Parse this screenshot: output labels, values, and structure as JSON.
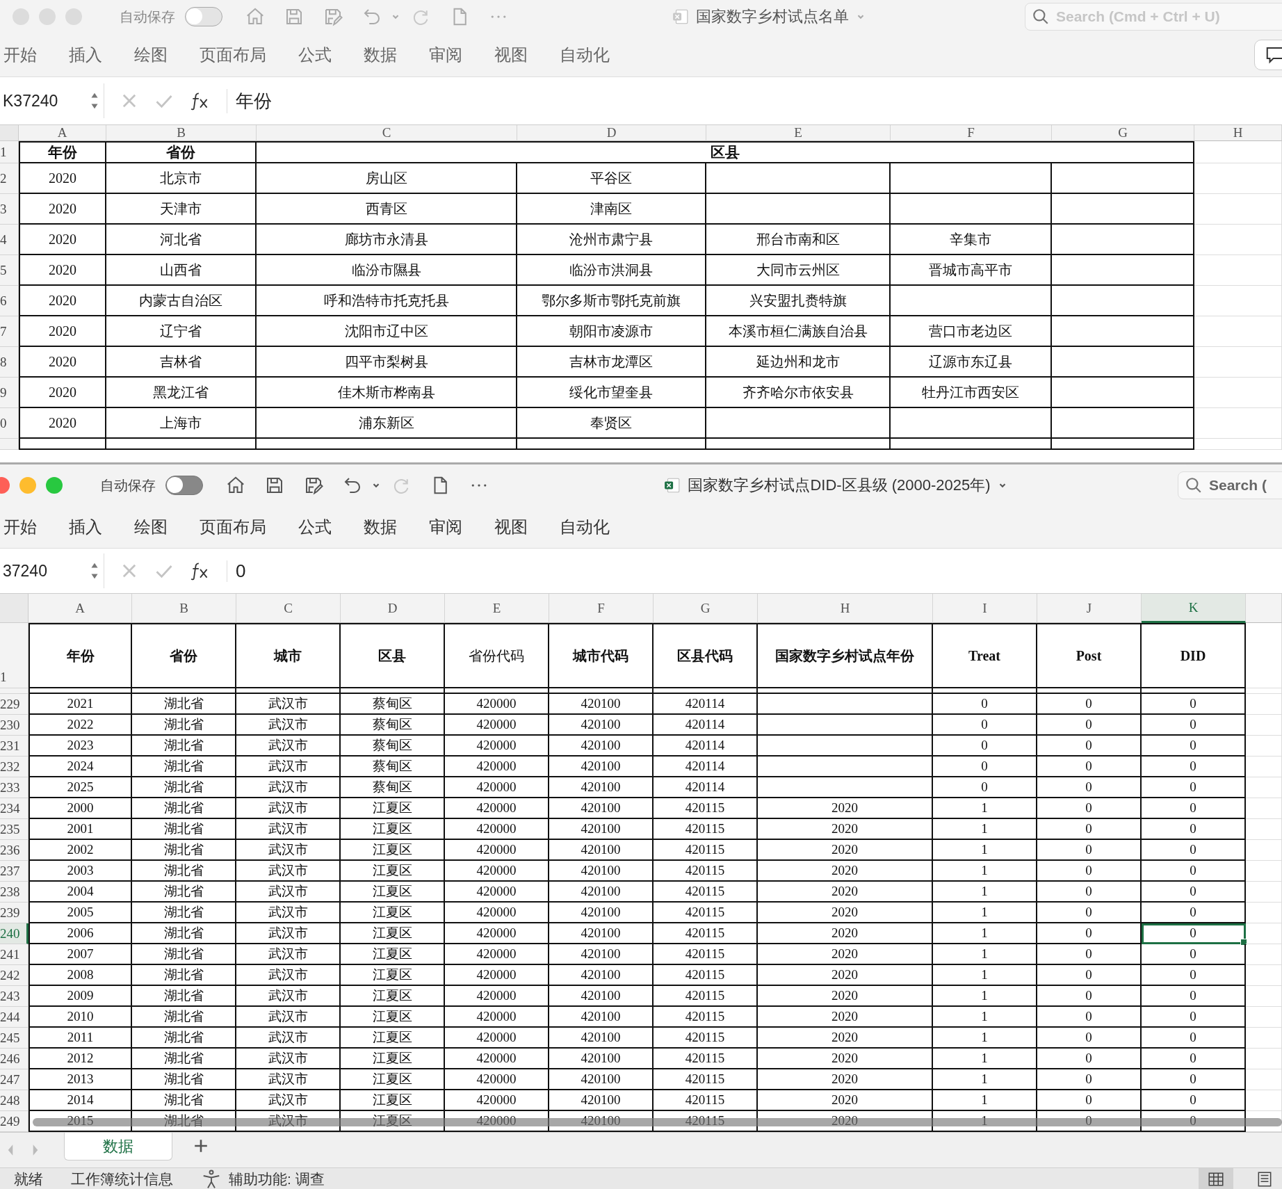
{
  "back_window": {
    "active": false,
    "autosave_label": "自动保存",
    "autosave_on": false,
    "title": "国家数字乡村试点名单",
    "search_placeholder": "Search (Cmd + Ctrl + U)",
    "comment_button": true,
    "ribbon_tabs": [
      "开始",
      "插入",
      "绘图",
      "页面布局",
      "公式",
      "数据",
      "审阅",
      "视图",
      "自动化"
    ],
    "name_box": "K37240",
    "formula": "年份",
    "columns": [
      "A",
      "B",
      "C",
      "D",
      "E",
      "F",
      "G",
      "H"
    ],
    "header_row": {
      "number": "1",
      "cells": [
        "年份",
        "省份",
        "区县"
      ]
    },
    "rows": [
      {
        "number": "2",
        "cells": [
          "2020",
          "北京市",
          "房山区",
          "平谷区",
          null,
          null,
          null
        ]
      },
      {
        "number": "3",
        "cells": [
          "2020",
          "天津市",
          "西青区",
          "津南区",
          null,
          null,
          null
        ]
      },
      {
        "number": "4",
        "cells": [
          "2020",
          "河北省",
          "廊坊市永清县",
          "沧州市肃宁县",
          "邢台市南和区",
          "辛集市",
          null
        ]
      },
      {
        "number": "5",
        "cells": [
          "2020",
          "山西省",
          "临汾市隰县",
          "临汾市洪洞县",
          "大同市云州区",
          "晋城市高平市",
          null
        ]
      },
      {
        "number": "6",
        "cells": [
          "2020",
          "内蒙古自治区",
          "呼和浩特市托克托县",
          "鄂尔多斯市鄂托克前旗",
          "兴安盟扎赉特旗",
          null,
          null
        ]
      },
      {
        "number": "7",
        "cells": [
          "2020",
          "辽宁省",
          "沈阳市辽中区",
          "朝阳市凌源市",
          "本溪市桓仁满族自治县",
          "营口市老边区",
          null
        ]
      },
      {
        "number": "8",
        "cells": [
          "2020",
          "吉林省",
          "四平市梨树县",
          "吉林市龙潭区",
          "延边州和龙市",
          "辽源市东辽县",
          null
        ]
      },
      {
        "number": "9",
        "cells": [
          "2020",
          "黑龙江省",
          "佳木斯市桦南县",
          "绥化市望奎县",
          "齐齐哈尔市依安县",
          "牡丹江市西安区",
          null
        ]
      },
      {
        "number": "0",
        "cells": [
          "2020",
          "上海市",
          "浦东新区",
          "奉贤区",
          null,
          null,
          null
        ]
      }
    ]
  },
  "front_window": {
    "active": true,
    "autosave_label": "自动保存",
    "autosave_on": false,
    "title": "国家数字乡村试点DID-区县级 (2000-2025年)",
    "search_placeholder": "Search (",
    "ribbon_tabs": [
      "开始",
      "插入",
      "绘图",
      "页面布局",
      "公式",
      "数据",
      "审阅",
      "视图",
      "自动化"
    ],
    "name_box": "37240",
    "formula": "0",
    "columns": [
      {
        "letter": "A",
        "selected": false
      },
      {
        "letter": "B",
        "selected": false
      },
      {
        "letter": "C",
        "selected": false
      },
      {
        "letter": "D",
        "selected": false
      },
      {
        "letter": "E",
        "selected": false
      },
      {
        "letter": "F",
        "selected": false
      },
      {
        "letter": "G",
        "selected": false
      },
      {
        "letter": "H",
        "selected": false
      },
      {
        "letter": "I",
        "selected": false
      },
      {
        "letter": "J",
        "selected": false
      },
      {
        "letter": "K",
        "selected": true
      }
    ],
    "header_row": {
      "number": "1",
      "cells": [
        {
          "text": "年份",
          "bold": true
        },
        {
          "text": "省份",
          "bold": true
        },
        {
          "text": "城市",
          "bold": true
        },
        {
          "text": "区县",
          "bold": true
        },
        {
          "text": "省份代码",
          "bold": false
        },
        {
          "text": "城市代码",
          "bold": true
        },
        {
          "text": "区县代码",
          "bold": true
        },
        {
          "text": "国家数字乡村试点年份",
          "bold": true
        },
        {
          "text": "Treat",
          "bold": true
        },
        {
          "text": "Post",
          "bold": true
        },
        {
          "text": "DID",
          "bold": true
        }
      ]
    },
    "rows": [
      {
        "number": "229",
        "selected": false,
        "cells": [
          "2021",
          "湖北省",
          "武汉市",
          "蔡甸区",
          "420000",
          "420100",
          "420114",
          null,
          "0",
          "0",
          "0"
        ]
      },
      {
        "number": "230",
        "selected": false,
        "cells": [
          "2022",
          "湖北省",
          "武汉市",
          "蔡甸区",
          "420000",
          "420100",
          "420114",
          null,
          "0",
          "0",
          "0"
        ]
      },
      {
        "number": "231",
        "selected": false,
        "cells": [
          "2023",
          "湖北省",
          "武汉市",
          "蔡甸区",
          "420000",
          "420100",
          "420114",
          null,
          "0",
          "0",
          "0"
        ]
      },
      {
        "number": "232",
        "selected": false,
        "cells": [
          "2024",
          "湖北省",
          "武汉市",
          "蔡甸区",
          "420000",
          "420100",
          "420114",
          null,
          "0",
          "0",
          "0"
        ]
      },
      {
        "number": "233",
        "selected": false,
        "cells": [
          "2025",
          "湖北省",
          "武汉市",
          "蔡甸区",
          "420000",
          "420100",
          "420114",
          null,
          "0",
          "0",
          "0"
        ]
      },
      {
        "number": "234",
        "selected": false,
        "cells": [
          "2000",
          "湖北省",
          "武汉市",
          "江夏区",
          "420000",
          "420100",
          "420115",
          "2020",
          "1",
          "0",
          "0"
        ]
      },
      {
        "number": "235",
        "selected": false,
        "cells": [
          "2001",
          "湖北省",
          "武汉市",
          "江夏区",
          "420000",
          "420100",
          "420115",
          "2020",
          "1",
          "0",
          "0"
        ]
      },
      {
        "number": "236",
        "selected": false,
        "cells": [
          "2002",
          "湖北省",
          "武汉市",
          "江夏区",
          "420000",
          "420100",
          "420115",
          "2020",
          "1",
          "0",
          "0"
        ]
      },
      {
        "number": "237",
        "selected": false,
        "cells": [
          "2003",
          "湖北省",
          "武汉市",
          "江夏区",
          "420000",
          "420100",
          "420115",
          "2020",
          "1",
          "0",
          "0"
        ]
      },
      {
        "number": "238",
        "selected": false,
        "cells": [
          "2004",
          "湖北省",
          "武汉市",
          "江夏区",
          "420000",
          "420100",
          "420115",
          "2020",
          "1",
          "0",
          "0"
        ]
      },
      {
        "number": "239",
        "selected": false,
        "cells": [
          "2005",
          "湖北省",
          "武汉市",
          "江夏区",
          "420000",
          "420100",
          "420115",
          "2020",
          "1",
          "0",
          "0"
        ]
      },
      {
        "number": "240",
        "selected": true,
        "cells": [
          "2006",
          "湖北省",
          "武汉市",
          "江夏区",
          "420000",
          "420100",
          "420115",
          "2020",
          "1",
          "0",
          "0"
        ]
      },
      {
        "number": "241",
        "selected": false,
        "cells": [
          "2007",
          "湖北省",
          "武汉市",
          "江夏区",
          "420000",
          "420100",
          "420115",
          "2020",
          "1",
          "0",
          "0"
        ]
      },
      {
        "number": "242",
        "selected": false,
        "cells": [
          "2008",
          "湖北省",
          "武汉市",
          "江夏区",
          "420000",
          "420100",
          "420115",
          "2020",
          "1",
          "0",
          "0"
        ]
      },
      {
        "number": "243",
        "selected": false,
        "cells": [
          "2009",
          "湖北省",
          "武汉市",
          "江夏区",
          "420000",
          "420100",
          "420115",
          "2020",
          "1",
          "0",
          "0"
        ]
      },
      {
        "number": "244",
        "selected": false,
        "cells": [
          "2010",
          "湖北省",
          "武汉市",
          "江夏区",
          "420000",
          "420100",
          "420115",
          "2020",
          "1",
          "0",
          "0"
        ]
      },
      {
        "number": "245",
        "selected": false,
        "cells": [
          "2011",
          "湖北省",
          "武汉市",
          "江夏区",
          "420000",
          "420100",
          "420115",
          "2020",
          "1",
          "0",
          "0"
        ]
      },
      {
        "number": "246",
        "selected": false,
        "cells": [
          "2012",
          "湖北省",
          "武汉市",
          "江夏区",
          "420000",
          "420100",
          "420115",
          "2020",
          "1",
          "0",
          "0"
        ]
      },
      {
        "number": "247",
        "selected": false,
        "cells": [
          "2013",
          "湖北省",
          "武汉市",
          "江夏区",
          "420000",
          "420100",
          "420115",
          "2020",
          "1",
          "0",
          "0"
        ]
      },
      {
        "number": "248",
        "selected": false,
        "cells": [
          "2014",
          "湖北省",
          "武汉市",
          "江夏区",
          "420000",
          "420100",
          "420115",
          "2020",
          "1",
          "0",
          "0"
        ]
      },
      {
        "number": "249",
        "selected": false,
        "cells": [
          "2015",
          "湖北省",
          "武汉市",
          "江夏区",
          "420000",
          "420100",
          "420115",
          "2020",
          "1",
          "0",
          "0"
        ]
      }
    ],
    "sheet_tabs": [
      {
        "label": "数据",
        "selected": true
      }
    ],
    "status_bar": {
      "ready": "就绪",
      "stats": "工作簿统计信息",
      "accessibility": "辅助功能: 调查"
    }
  }
}
